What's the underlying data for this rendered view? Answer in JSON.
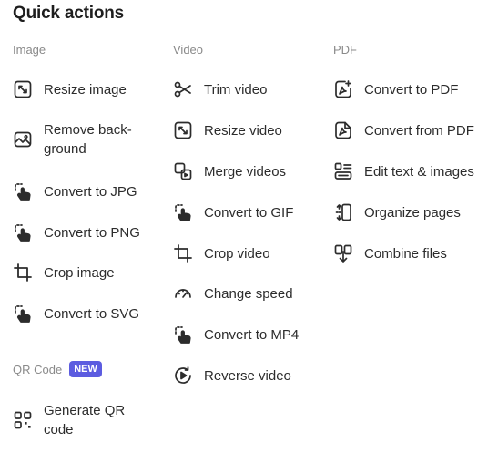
{
  "title": "Quick actions",
  "sections": {
    "image": {
      "label": "Image",
      "items": [
        {
          "label": "Resize image",
          "icon": "resize-icon"
        },
        {
          "label": "Remove back-\nground",
          "icon": "remove-background-icon"
        },
        {
          "label": "Convert to JPG",
          "icon": "convert-hand-icon"
        },
        {
          "label": "Convert to PNG",
          "icon": "convert-hand-icon"
        },
        {
          "label": "Crop image",
          "icon": "crop-icon"
        },
        {
          "label": "Convert to SVG",
          "icon": "convert-hand-icon"
        }
      ]
    },
    "qr": {
      "label": "QR Code",
      "badge": "NEW",
      "items": [
        {
          "label": "Generate QR\ncode",
          "icon": "qr-code-icon"
        }
      ]
    },
    "video": {
      "label": "Video",
      "items": [
        {
          "label": "Trim video",
          "icon": "scissors-icon"
        },
        {
          "label": "Resize video",
          "icon": "resize-icon"
        },
        {
          "label": "Merge videos",
          "icon": "merge-icon"
        },
        {
          "label": "Convert to GIF",
          "icon": "convert-hand-icon"
        },
        {
          "label": "Crop video",
          "icon": "crop-icon"
        },
        {
          "label": "Change speed",
          "icon": "speedometer-icon"
        },
        {
          "label": "Convert to MP4",
          "icon": "convert-hand-icon"
        },
        {
          "label": "Reverse video",
          "icon": "reverse-video-icon"
        }
      ]
    },
    "pdf": {
      "label": "PDF",
      "items": [
        {
          "label": "Convert to PDF",
          "icon": "convert-to-pdf-icon"
        },
        {
          "label": "Convert from PDF",
          "icon": "pdf-file-icon"
        },
        {
          "label": "Edit text & images",
          "icon": "edit-text-images-icon"
        },
        {
          "label": "Organize pages",
          "icon": "organize-pages-icon"
        },
        {
          "label": "Combine files",
          "icon": "combine-files-icon"
        }
      ]
    }
  },
  "colors": {
    "badge": "#5c5ce0",
    "text": "#2c2c2c",
    "section_label": "#8a8a8a"
  }
}
